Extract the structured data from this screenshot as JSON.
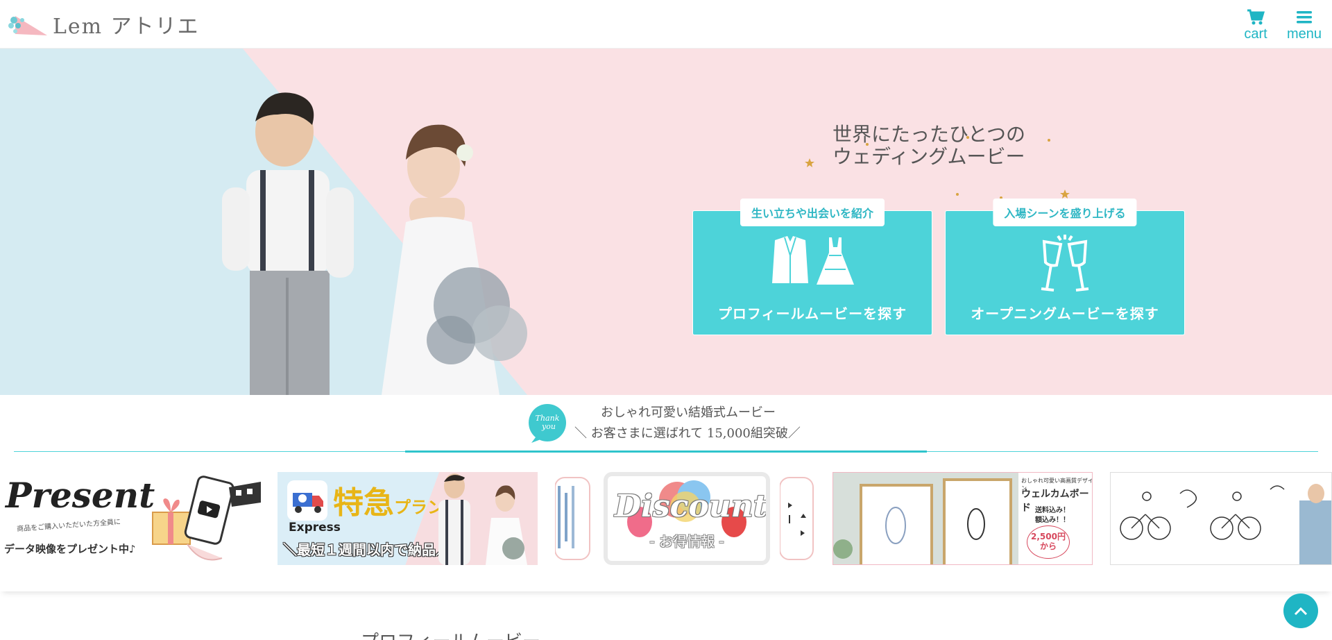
{
  "header": {
    "logo_text": "Lem アトリエ",
    "cart_label": "cart",
    "menu_label": "menu"
  },
  "hero": {
    "tagline_line1": "世界にたったひとつの",
    "tagline_line2": "ウェディングムービー",
    "cards": [
      {
        "tag": "生い立ちや出会いを紹介",
        "label": "プロフィールムービーを探す",
        "icon": "tuxedo-dress-icon"
      },
      {
        "tag": "入場シーンを盛り上げる",
        "label": "オープニングムービーを探す",
        "icon": "champagne-glasses-icon"
      }
    ]
  },
  "message": {
    "badge_text": "Thank you",
    "line1": "おしゃれ可愛い結婚式ムービー",
    "line2": "＼ お客さまに選ばれて 15,000組突破／"
  },
  "banners": {
    "present": {
      "title": "Present",
      "sub": "商品をご購入いただいた方全員に",
      "main": "データ映像をプレゼント中♪"
    },
    "express": {
      "title": "特急",
      "title_small": "プラン",
      "en": "Express",
      "main": "＼最短１週間以内で納品／"
    },
    "discount": {
      "title": "Discount",
      "sub": "- お得情報 -"
    },
    "welcome": {
      "sub": "おしゃれ可愛い高画質デザイン",
      "title": "ウェルカムボード",
      "ship1": "送料込み！",
      "ship2": "額込み！！",
      "price": "2,500円",
      "price_suffix": "から"
    }
  },
  "section": {
    "title": "プロフィールムービー"
  },
  "colors": {
    "accent": "#4dd3d9",
    "accent_dark": "#1fb5c4",
    "hero_pink": "#fae1e4",
    "hero_blue": "#d5ebf2"
  }
}
